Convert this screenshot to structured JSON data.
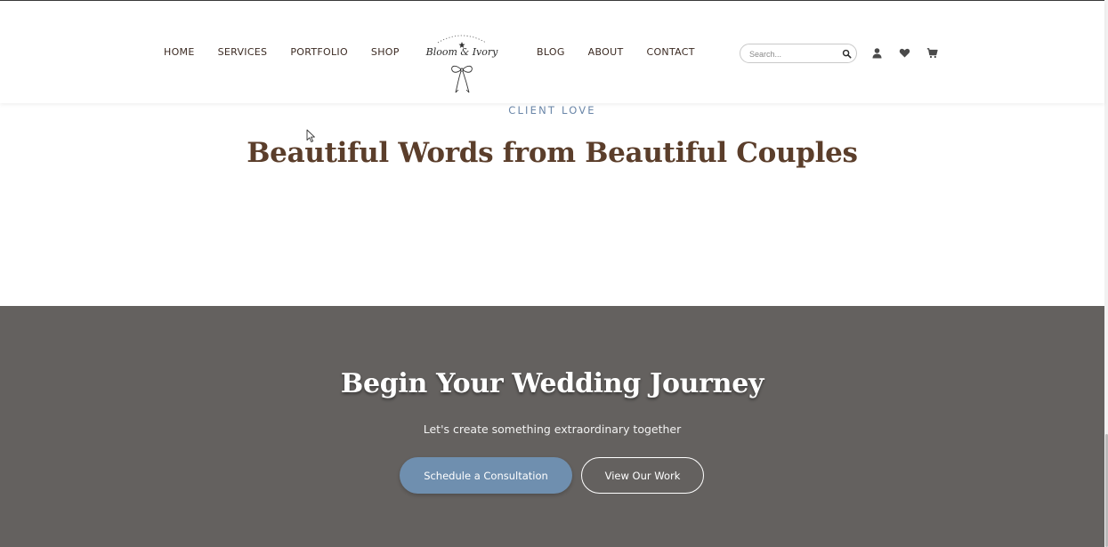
{
  "header": {
    "nav_left": [
      "HOME",
      "SERVICES",
      "PORTFOLIO",
      "SHOP"
    ],
    "nav_right": [
      "BLOG",
      "ABOUT",
      "CONTACT"
    ],
    "logo_text": "Bloom & Ivory",
    "search": {
      "placeholder": "Search..."
    },
    "icons": [
      "account-icon",
      "wishlist-heart-icon",
      "cart-icon"
    ]
  },
  "testimonials": {
    "eyebrow": "CLIENT LOVE",
    "heading": "Beautiful Words from Beautiful Couples"
  },
  "cta": {
    "heading": "Begin Your Wedding Journey",
    "subheading": "Let's create something extraordinary together",
    "primary_button": "Schedule a Consultation",
    "secondary_button": "View Our Work"
  },
  "colors": {
    "brown_text": "#5b3e2b",
    "eyebrow_blue": "#6a86a8",
    "cta_background": "#64615f",
    "primary_button": "#6f8faf"
  }
}
